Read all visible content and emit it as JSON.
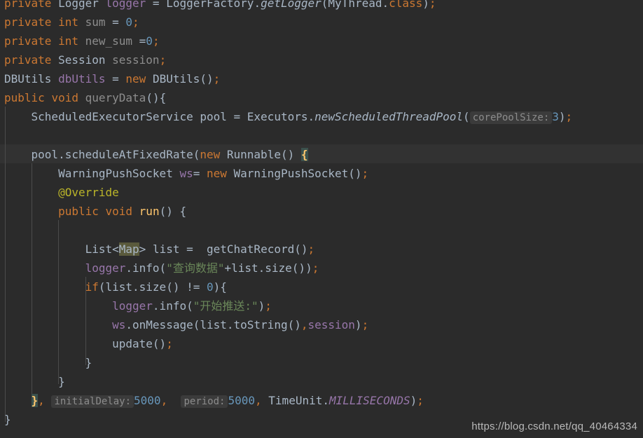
{
  "editor": {
    "theme": "darcula",
    "background": "#2b2b2b",
    "foreground": "#a9b7c6",
    "font_size_px": 16,
    "line_height_px": 27,
    "current_line_background": "#323232",
    "indent_guide_color": "#4b4b4b",
    "colors": {
      "keyword": "#cc7832",
      "field": "#9876aa",
      "number": "#6897bb",
      "string": "#6a8759",
      "annotation": "#bbb529",
      "local_variable": "#8d8d8d",
      "method_declaration": "#ffc66d",
      "inlay_hint_text": "#8c8c8c",
      "inlay_hint_background": "#3b3b3b",
      "brace_match_background": "#3b514d",
      "identifier_highlight_background": "#5a5a3c"
    }
  },
  "code": {
    "language": "Java",
    "lines": [
      {
        "n": 1,
        "text": "private Logger logger = LoggerFactory.getLogger(MyThread.class);",
        "tokens": [
          {
            "t": "private ",
            "c": "kw"
          },
          {
            "t": "Logger ",
            "c": "def"
          },
          {
            "t": "logger",
            "c": "field"
          },
          {
            "t": " = ",
            "c": "punct"
          },
          {
            "t": "LoggerFactory",
            "c": "def"
          },
          {
            "t": ".",
            "c": "punct"
          },
          {
            "t": "getLogger",
            "c": "static"
          },
          {
            "t": "(MyThread.",
            "c": "punct"
          },
          {
            "t": "class",
            "c": "kw"
          },
          {
            "t": ")",
            "c": "punct"
          },
          {
            "t": ";",
            "c": "semi"
          }
        ]
      },
      {
        "n": 2,
        "text": "private int sum = 0;",
        "tokens": [
          {
            "t": "private ",
            "c": "kw"
          },
          {
            "t": "int ",
            "c": "kw"
          },
          {
            "t": "sum",
            "c": "grey"
          },
          {
            "t": " = ",
            "c": "punct"
          },
          {
            "t": "0",
            "c": "num"
          },
          {
            "t": ";",
            "c": "semi"
          }
        ]
      },
      {
        "n": 3,
        "text": "private int new_sum =0;",
        "tokens": [
          {
            "t": "private ",
            "c": "kw"
          },
          {
            "t": "int ",
            "c": "kw"
          },
          {
            "t": "new_sum",
            "c": "grey"
          },
          {
            "t": " =",
            "c": "punct"
          },
          {
            "t": "0",
            "c": "num"
          },
          {
            "t": ";",
            "c": "semi"
          }
        ]
      },
      {
        "n": 4,
        "text": "private Session session;",
        "tokens": [
          {
            "t": "private ",
            "c": "kw"
          },
          {
            "t": "Session ",
            "c": "def"
          },
          {
            "t": "session",
            "c": "grey"
          },
          {
            "t": ";",
            "c": "semi"
          }
        ]
      },
      {
        "n": 5,
        "text": "DBUtils dbUtils = new DBUtils();",
        "tokens": [
          {
            "t": "DBUtils ",
            "c": "def"
          },
          {
            "t": "dbUtils",
            "c": "field"
          },
          {
            "t": " = ",
            "c": "punct"
          },
          {
            "t": "new ",
            "c": "kw"
          },
          {
            "t": "DBUtils()",
            "c": "punct"
          },
          {
            "t": ";",
            "c": "semi"
          }
        ]
      },
      {
        "n": 6,
        "text": "public void queryData(){",
        "tokens": [
          {
            "t": "public ",
            "c": "kw"
          },
          {
            "t": "void ",
            "c": "kw"
          },
          {
            "t": "queryData",
            "c": "grey"
          },
          {
            "t": "(){",
            "c": "punct"
          }
        ]
      },
      {
        "n": 7,
        "text": "    ScheduledExecutorService pool = Executors.newScheduledThreadPool( corePoolSize: 3);",
        "hint": "corePoolSize:",
        "tokens": [
          {
            "t": "    ScheduledExecutorService pool = Executors",
            "c": "def"
          },
          {
            "t": ".",
            "c": "punct"
          },
          {
            "t": "newScheduledThreadPool",
            "c": "static"
          },
          {
            "t": "(",
            "c": "punct"
          },
          {
            "t": "corePoolSize:",
            "c": "hint"
          },
          {
            "t": "3",
            "c": "num"
          },
          {
            "t": ")",
            "c": "punct"
          },
          {
            "t": ";",
            "c": "semi"
          }
        ]
      },
      {
        "n": 8,
        "text": "",
        "tokens": []
      },
      {
        "n": 9,
        "text": "    pool.scheduleAtFixedRate(new Runnable() {",
        "current_line": true,
        "tokens": [
          {
            "t": "    pool.scheduleAtFixedRate(",
            "c": "def"
          },
          {
            "t": "new ",
            "c": "kw"
          },
          {
            "t": "Runnable() ",
            "c": "def"
          },
          {
            "t": "{",
            "c": "brace-hl"
          }
        ]
      },
      {
        "n": 10,
        "text": "        WarningPushSocket ws= new WarningPushSocket();",
        "tokens": [
          {
            "t": "        WarningPushSocket ",
            "c": "def"
          },
          {
            "t": "ws",
            "c": "field"
          },
          {
            "t": "= ",
            "c": "punct"
          },
          {
            "t": "new ",
            "c": "kw"
          },
          {
            "t": "WarningPushSocket()",
            "c": "def"
          },
          {
            "t": ";",
            "c": "semi"
          }
        ]
      },
      {
        "n": 11,
        "text": "        @Override",
        "tokens": [
          {
            "t": "        @Override",
            "c": "anno"
          }
        ]
      },
      {
        "n": 12,
        "text": "        public void run() {",
        "tokens": [
          {
            "t": "        public ",
            "c": "kw"
          },
          {
            "t": "void ",
            "c": "kw"
          },
          {
            "t": "run",
            "c": "methy"
          },
          {
            "t": "() {",
            "c": "punct"
          }
        ]
      },
      {
        "n": 13,
        "text": "",
        "tokens": []
      },
      {
        "n": 14,
        "text": "            List<Map> list =  getChatRecord();",
        "tokens": [
          {
            "t": "            List<",
            "c": "def"
          },
          {
            "t": "Map",
            "c": "ident-hl"
          },
          {
            "t": "> list =  getChatRecord()",
            "c": "def"
          },
          {
            "t": ";",
            "c": "semi"
          }
        ]
      },
      {
        "n": 15,
        "text": "            logger.info(\"查询数据\"+list.size());",
        "tokens": [
          {
            "t": "            ",
            "c": "def"
          },
          {
            "t": "logger",
            "c": "field"
          },
          {
            "t": ".info(",
            "c": "def"
          },
          {
            "t": "\"查询数据\"",
            "c": "str"
          },
          {
            "t": "+list.size())",
            "c": "def"
          },
          {
            "t": ";",
            "c": "semi"
          }
        ]
      },
      {
        "n": 16,
        "text": "            if(list.size() != 0){",
        "tokens": [
          {
            "t": "            ",
            "c": "def"
          },
          {
            "t": "if",
            "c": "kw"
          },
          {
            "t": "(list.size() != ",
            "c": "def"
          },
          {
            "t": "0",
            "c": "num"
          },
          {
            "t": "){",
            "c": "punct"
          }
        ]
      },
      {
        "n": 17,
        "text": "                logger.info(\"开始推送:\");",
        "tokens": [
          {
            "t": "                ",
            "c": "def"
          },
          {
            "t": "logger",
            "c": "field"
          },
          {
            "t": ".info(",
            "c": "def"
          },
          {
            "t": "\"开始推送:\"",
            "c": "str"
          },
          {
            "t": ")",
            "c": "punct"
          },
          {
            "t": ";",
            "c": "semi"
          }
        ]
      },
      {
        "n": 18,
        "text": "                ws.onMessage(list.toString(),session);",
        "tokens": [
          {
            "t": "                ",
            "c": "def"
          },
          {
            "t": "ws",
            "c": "field"
          },
          {
            "t": ".onMessage(list.toString()",
            "c": "def"
          },
          {
            "t": ",",
            "c": "semi"
          },
          {
            "t": "session",
            "c": "field"
          },
          {
            "t": ")",
            "c": "punct"
          },
          {
            "t": ";",
            "c": "semi"
          }
        ]
      },
      {
        "n": 19,
        "text": "                update();",
        "tokens": [
          {
            "t": "                update()",
            "c": "def"
          },
          {
            "t": ";",
            "c": "semi"
          }
        ]
      },
      {
        "n": 20,
        "text": "            }",
        "tokens": [
          {
            "t": "            }",
            "c": "brace"
          }
        ]
      },
      {
        "n": 21,
        "text": "        }",
        "tokens": [
          {
            "t": "        }",
            "c": "brace"
          }
        ]
      },
      {
        "n": 22,
        "text": "    }, initialDelay: 5000,  period: 5000, TimeUnit.MILLISECONDS);",
        "hints": [
          "initialDelay:",
          "period:"
        ],
        "tokens": [
          {
            "t": "    ",
            "c": "def"
          },
          {
            "t": "}",
            "c": "brace-hl"
          },
          {
            "t": ",",
            "c": "semi"
          },
          {
            "t": " ",
            "c": "def"
          },
          {
            "t": "initialDelay:",
            "c": "hint"
          },
          {
            "t": "5000",
            "c": "num"
          },
          {
            "t": ",",
            "c": "semi"
          },
          {
            "t": "  ",
            "c": "def"
          },
          {
            "t": "period:",
            "c": "hint"
          },
          {
            "t": "5000",
            "c": "num"
          },
          {
            "t": ",",
            "c": "semi"
          },
          {
            "t": " TimeUnit",
            "c": "def"
          },
          {
            "t": ".",
            "c": "punct"
          },
          {
            "t": "MILLISECONDS",
            "c": "statf"
          },
          {
            "t": ")",
            "c": "punct"
          },
          {
            "t": ";",
            "c": "semi"
          }
        ]
      },
      {
        "n": 23,
        "text": "}",
        "tokens": [
          {
            "t": "}",
            "c": "brace"
          }
        ]
      }
    ]
  },
  "watermark": {
    "text": "https://blog.csdn.net/qq_40464334"
  }
}
